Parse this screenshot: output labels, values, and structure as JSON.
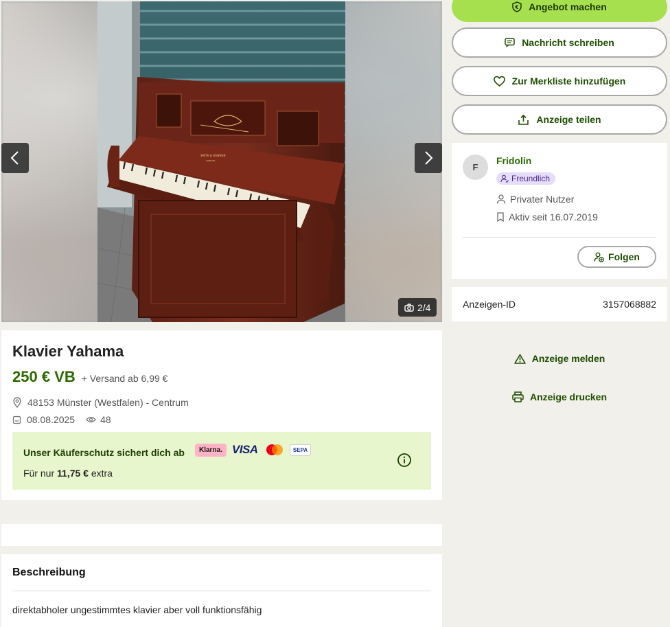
{
  "gallery": {
    "counter": "2/4",
    "brand_plate_1": "SMITH & DAWSON",
    "brand_plate_2": "LONDON"
  },
  "ad": {
    "title": "Klavier Yahama",
    "price": "250 € VB",
    "shipping": "+ Versand ab 6,99 €",
    "location": "48153 Münster (Westfalen) - Centrum",
    "date": "08.08.2025",
    "views": "48"
  },
  "protection": {
    "title": "Unser Käuferschutz sichert dich ab",
    "sub_prefix": "Für nur",
    "sub_amount": "11,75 €",
    "sub_suffix": "extra",
    "logos": {
      "klarna": "Klarna.",
      "visa": "VISA",
      "sepa": "SEPA"
    }
  },
  "description": {
    "title": "Beschreibung",
    "text": "direktabholer ungestimmtes klavier aber voll funktionsfähig"
  },
  "actions": {
    "offer": "Angebot machen",
    "message": "Nachricht schreiben",
    "watchlist": "Zur Merkliste hinzufügen",
    "share": "Anzeige teilen",
    "report": "Anzeige melden",
    "print": "Anzeige drucken"
  },
  "seller": {
    "initial": "F",
    "name": "Fridolin",
    "badge": "Freundlich",
    "type": "Privater Nutzer",
    "since": "Aktiv seit 16.07.2019",
    "follow": "Folgen"
  },
  "ad_id": {
    "label": "Anzeigen-ID",
    "value": "3157068882"
  },
  "colors": {
    "accent_green": "#a7e04e",
    "text_green": "#2c6a00",
    "protect_bg": "#e8f6cd",
    "badge_bg": "#e6dcfb",
    "page_bg": "#f1f0eb"
  }
}
